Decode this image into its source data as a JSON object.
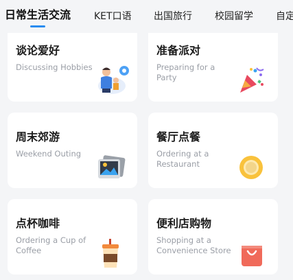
{
  "tabs": [
    {
      "label": "日常生活交流",
      "active": true
    },
    {
      "label": "KET口语",
      "active": false
    },
    {
      "label": "出国旅行",
      "active": false
    },
    {
      "label": "校园留学",
      "active": false
    },
    {
      "label": "自定",
      "active": false
    }
  ],
  "colors": {
    "accent": "#2a8cf0"
  },
  "cards": [
    {
      "title": "谈论爱好",
      "subtitle": "Discussing Hobbies",
      "icon": "family-icon"
    },
    {
      "title": "准备派对",
      "subtitle": "Preparing for a Party",
      "icon": "party-popper-icon"
    },
    {
      "title": "周末郊游",
      "subtitle": "Weekend Outing",
      "icon": "photo-album-icon"
    },
    {
      "title": "餐厅点餐",
      "subtitle": "Ordering at a Restaurant",
      "icon": "plate-icon"
    },
    {
      "title": "点杯咖啡",
      "subtitle": "Ordering a Cup of Coffee",
      "icon": "coffee-cup-icon"
    },
    {
      "title": "便利店购物",
      "subtitle": "Shopping at a Convenience Store",
      "icon": "shopping-bag-icon"
    }
  ]
}
